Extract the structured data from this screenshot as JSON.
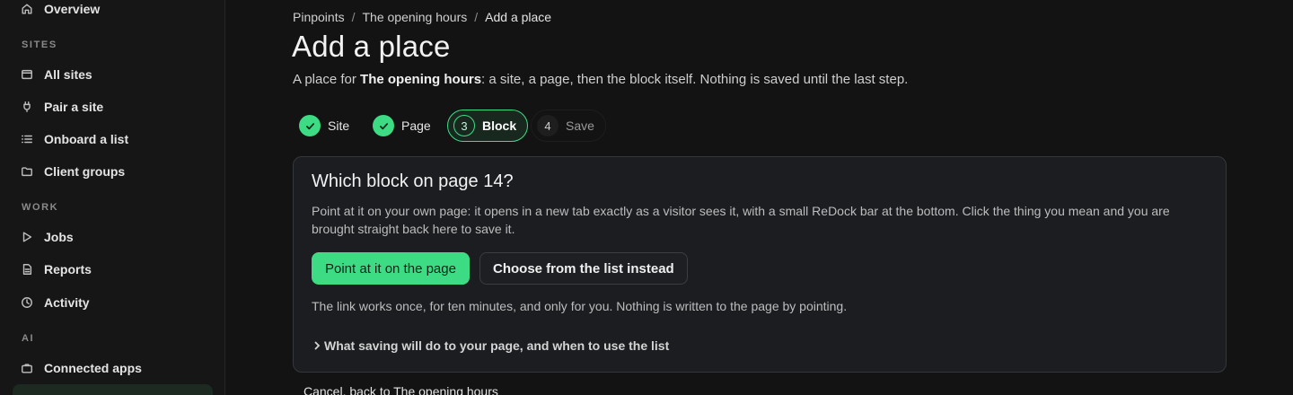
{
  "sidebar": {
    "top_item": {
      "label": "Overview",
      "icon": "home-icon"
    },
    "sections": [
      {
        "label": "SITES",
        "items": [
          {
            "label": "All sites",
            "icon": "window-icon"
          },
          {
            "label": "Pair a site",
            "icon": "plug-icon"
          },
          {
            "label": "Onboard a list",
            "icon": "list-icon"
          },
          {
            "label": "Client groups",
            "icon": "folder-icon"
          }
        ]
      },
      {
        "label": "WORK",
        "items": [
          {
            "label": "Jobs",
            "icon": "play-icon"
          },
          {
            "label": "Reports",
            "icon": "document-icon"
          },
          {
            "label": "Activity",
            "icon": "clock-icon"
          }
        ]
      },
      {
        "label": "AI",
        "items": [
          {
            "label": "Connected apps",
            "icon": "briefcase-icon"
          }
        ]
      }
    ]
  },
  "breadcrumb": {
    "items": [
      "Pinpoints",
      "The opening hours",
      "Add a place"
    ],
    "separator": "/"
  },
  "page": {
    "title": "Add a place",
    "subtitle_prefix": "A place for ",
    "subtitle_bold": "The opening hours",
    "subtitle_suffix": ": a site, a page, then the block itself. Nothing is saved until the last step."
  },
  "stepper": {
    "steps": [
      {
        "label": "Site",
        "state": "done"
      },
      {
        "label": "Page",
        "state": "done"
      },
      {
        "number": "3",
        "label": "Block",
        "state": "current"
      },
      {
        "number": "4",
        "label": "Save",
        "state": "pending"
      }
    ]
  },
  "card": {
    "title": "Which block on page 14?",
    "description": "Point at it on your own page: it opens in a new tab exactly as a visitor sees it, with a small ReDock bar at the bottom. Click the thing you mean and you are brought straight back here to save it.",
    "primary_button": "Point at it on the page",
    "secondary_button": "Choose from the list instead",
    "note": "The link works once, for ten minutes, and only for you. Nothing is written to the page by pointing.",
    "disclosure": "What saving will do to your page, and when to use the list"
  },
  "footer": {
    "cancel_link": "Cancel, back to The opening hours"
  },
  "colors": {
    "accent": "#3ddc84",
    "background": "#131313",
    "sidebar": "#161616",
    "card": "#1b1d20"
  }
}
